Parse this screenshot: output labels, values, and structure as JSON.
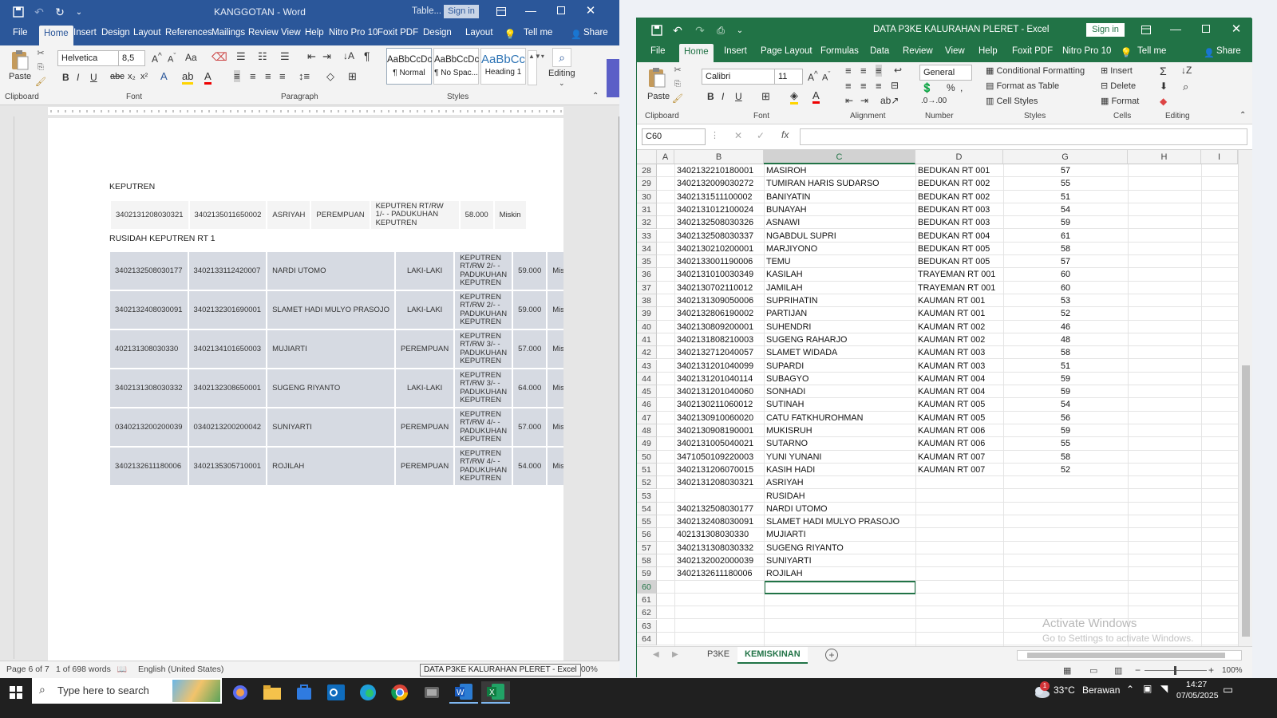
{
  "word": {
    "title": "KANGGOTAN - Word",
    "context_title": "Table...",
    "sign_in": "Sign in",
    "tabs": [
      "File",
      "Home",
      "Insert",
      "Design",
      "Layout",
      "References",
      "Mailings",
      "Review",
      "View",
      "Help",
      "Nitro Pro 10",
      "Foxit PDF",
      "Design",
      "Layout"
    ],
    "tell_me": "Tell me",
    "share": "Share",
    "ribbon": {
      "paste": "Paste",
      "font_name": "Helvetica",
      "font_size": "8,5",
      "clipboard": "Clipboard",
      "font": "Font",
      "paragraph": "Paragraph",
      "styles": "Styles",
      "editing": "Editing",
      "style_normal": "¶ Normal",
      "style_nospace": "¶ No Spac...",
      "style_heading": "Heading 1",
      "style_sample": "AaBbCcDc",
      "style_sample2": "AaBbCcDc",
      "style_sample3": "AaBbCc"
    },
    "doc": {
      "heading1": "KEPUTREN",
      "table1": [
        [
          "3402131208030321",
          "3402135011650002",
          "ASRIYAH",
          "PEREMPUAN",
          "KEPUTREN RT/RW 1/- - PADUKUHAN KEPUTREN",
          "58.000",
          "Miskin"
        ]
      ],
      "heading2": "RUSIDAH KEPUTREN RT 1",
      "table2": [
        [
          "3402132508030177",
          "3402133112420007",
          "NARDI UTOMO",
          "LAKI-LAKI",
          "KEPUTREN RT/RW 2/- - PADUKUHAN KEPUTREN",
          "59.000",
          "Mis"
        ],
        [
          "3402132408030091",
          "3402132301690001",
          "SLAMET HADI MULYO PRASOJO",
          "LAKI-LAKI",
          "KEPUTREN RT/RW 2/- - PADUKUHAN KEPUTREN",
          "59.000",
          "Mis"
        ],
        [
          "402131308030330",
          "3402134101650003",
          "MUJIARTI",
          "PEREMPUAN",
          "KEPUTREN RT/RW 3/- - PADUKUHAN KEPUTREN",
          "57.000",
          "Mis"
        ],
        [
          "3402131308030332",
          "3402132308650001",
          "SUGENG RIYANTO",
          "LAKI-LAKI",
          "KEPUTREN RT/RW 3/- - PADUKUHAN KEPUTREN",
          "64.000",
          "Mis"
        ],
        [
          "0340213200200039",
          "0340213200200042",
          "SUNIYARTI",
          "PEREMPUAN",
          "KEPUTREN RT/RW 4/- - PADUKUHAN KEPUTREN",
          "57.000",
          "Mis"
        ],
        [
          "3402132611180006",
          "3402135305710001",
          "ROJILAH",
          "PEREMPUAN",
          "KEPUTREN RT/RW 4/- - PADUKUHAN KEPUTREN",
          "54.000",
          "Mis"
        ]
      ]
    },
    "status": {
      "page": "Page 6 of 7",
      "words": "1 of 698 words",
      "language": "English (United States)",
      "zoom": "100%"
    }
  },
  "excel": {
    "title": "DATA P3KE KALURAHAN PLERET - Excel",
    "sign_in": "Sign in",
    "tabs": [
      "File",
      "Home",
      "Insert",
      "Page Layout",
      "Formulas",
      "Data",
      "Review",
      "View",
      "Help",
      "Foxit PDF",
      "Nitro Pro 10"
    ],
    "tell_me": "Tell me",
    "share": "Share",
    "ribbon": {
      "paste": "Paste",
      "font_name": "Calibri",
      "font_size": "11",
      "number_format": "General",
      "clipboard": "Clipboard",
      "font": "Font",
      "alignment": "Alignment",
      "number": "Number",
      "styles": "Styles",
      "cells": "Cells",
      "editing": "Editing",
      "conditional": "Conditional Formatting",
      "format_table": "Format as Table",
      "cell_styles": "Cell Styles",
      "insert": "Insert",
      "delete": "Delete",
      "format": "Format"
    },
    "name_box": "C60",
    "columns": [
      "A",
      "B",
      "C",
      "D",
      "G",
      "H",
      "I"
    ],
    "rows": [
      {
        "n": "28",
        "b": "3402132210180001",
        "c": "MASIROH",
        "d": "BEDUKAN RT 001",
        "g": "57"
      },
      {
        "n": "29",
        "b": "3402132009030272",
        "c": "TUMIRAN HARIS SUDARSO",
        "d": "BEDUKAN RT 002",
        "g": "55"
      },
      {
        "n": "30",
        "b": "3402131511100002",
        "c": "BANIYATIN",
        "d": "BEDUKAN RT 002",
        "g": "51"
      },
      {
        "n": "31",
        "b": "3402131012100024",
        "c": "BUNAYAH",
        "d": "BEDUKAN RT 003",
        "g": "54"
      },
      {
        "n": "32",
        "b": "3402132508030326",
        "c": "ASNAWI",
        "d": "BEDUKAN RT 003",
        "g": "59"
      },
      {
        "n": "33",
        "b": "3402132508030337",
        "c": "NGABDUL SUPRI",
        "d": "BEDUKAN RT 004",
        "g": "61"
      },
      {
        "n": "34",
        "b": "3402130210200001",
        "c": "MARJIYONO",
        "d": "BEDUKAN RT 005",
        "g": "58"
      },
      {
        "n": "35",
        "b": "3402133001190006",
        "c": "TEMU",
        "d": "BEDUKAN RT 005",
        "g": "57"
      },
      {
        "n": "36",
        "b": "3402131010030349",
        "c": "KASILAH",
        "d": "TRAYEMAN RT 001",
        "g": "60"
      },
      {
        "n": "37",
        "b": "3402130702110012",
        "c": "JAMILAH",
        "d": "TRAYEMAN RT 001",
        "g": "60"
      },
      {
        "n": "38",
        "b": "3402131309050006",
        "c": "SUPRIHATIN",
        "d": "KAUMAN RT 001",
        "g": "53"
      },
      {
        "n": "39",
        "b": "3402132806190002",
        "c": "PARTIJAN",
        "d": "KAUMAN RT 001",
        "g": "52"
      },
      {
        "n": "40",
        "b": "3402130809200001",
        "c": "SUHENDRI",
        "d": "KAUMAN RT 002",
        "g": "46"
      },
      {
        "n": "41",
        "b": "3402131808210003",
        "c": "SUGENG RAHARJO",
        "d": "KAUMAN RT 002",
        "g": "48"
      },
      {
        "n": "42",
        "b": "3402132712040057",
        "c": "SLAMET WIDADA",
        "d": "KAUMAN RT 003",
        "g": "58"
      },
      {
        "n": "43",
        "b": "3402131201040099",
        "c": "SUPARDI",
        "d": "KAUMAN RT 003",
        "g": "51"
      },
      {
        "n": "44",
        "b": "3402131201040114",
        "c": "SUBAGYO",
        "d": "KAUMAN RT 004",
        "g": "59"
      },
      {
        "n": "45",
        "b": "3402131201040060",
        "c": "SONHADI",
        "d": "KAUMAN RT 004",
        "g": "59"
      },
      {
        "n": "46",
        "b": "3402130211060012",
        "c": "SUTINAH",
        "d": "KAUMAN RT 005",
        "g": "54"
      },
      {
        "n": "47",
        "b": "3402130910060020",
        "c": "CATU FATKHUROHMAN",
        "d": "KAUMAN RT 005",
        "g": "56"
      },
      {
        "n": "48",
        "b": "3402130908190001",
        "c": "MUKISRUH",
        "d": "KAUMAN RT 006",
        "g": "59"
      },
      {
        "n": "49",
        "b": "3402131005040021",
        "c": "SUTARNO",
        "d": "KAUMAN RT 006",
        "g": "55"
      },
      {
        "n": "50",
        "b": "3471050109220003",
        "c": "YUNI YUNANI",
        "d": "KAUMAN RT 007",
        "g": "58"
      },
      {
        "n": "51",
        "b": "3402131206070015",
        "c": "KASIH HADI",
        "d": "KAUMAN RT 007",
        "g": "52"
      },
      {
        "n": "52",
        "b": "3402131208030321",
        "c": "ASRIYAH",
        "d": "",
        "g": ""
      },
      {
        "n": "53",
        "b": "",
        "c": "RUSIDAH",
        "d": "",
        "g": ""
      },
      {
        "n": "54",
        "b": "3402132508030177",
        "c": "NARDI UTOMO",
        "d": "",
        "g": ""
      },
      {
        "n": "55",
        "b": "3402132408030091",
        "c": "SLAMET HADI MULYO PRASOJO",
        "d": "",
        "g": ""
      },
      {
        "n": "56",
        "b": "402131308030330",
        "c": "MUJIARTI",
        "d": "",
        "g": ""
      },
      {
        "n": "57",
        "b": "3402131308030332",
        "c": "SUGENG RIYANTO",
        "d": "",
        "g": ""
      },
      {
        "n": "58",
        "b": "3402132002000039",
        "c": "SUNIYARTI",
        "d": "",
        "g": ""
      },
      {
        "n": "59",
        "b": "3402132611180006",
        "c": "ROJILAH",
        "d": "",
        "g": ""
      },
      {
        "n": "60",
        "b": "",
        "c": "",
        "d": "",
        "g": ""
      },
      {
        "n": "61",
        "b": "",
        "c": "",
        "d": "",
        "g": ""
      },
      {
        "n": "62",
        "b": "",
        "c": "",
        "d": "",
        "g": ""
      },
      {
        "n": "63",
        "b": "",
        "c": "",
        "d": "",
        "g": ""
      },
      {
        "n": "64",
        "b": "",
        "c": "",
        "d": "",
        "g": ""
      }
    ],
    "sheets": [
      "P3KE",
      "KEMISKINAN"
    ],
    "active_sheet": "KEMISKINAN",
    "watermark_title": "Activate Windows",
    "watermark_sub": "Go to Settings to activate Windows.",
    "zoom": "100%",
    "tooltip": "DATA P3KE KALURAHAN PLERET - Excel"
  },
  "taskbar": {
    "search_placeholder": "Type here to search",
    "weather_temp": "33°C",
    "weather_desc": "Berawan",
    "time": "14:27",
    "date": "07/05/2025",
    "notification_badge": "1"
  },
  "colors": {
    "word_blue": "#2b579a",
    "excel_green": "#217346",
    "taskbar": "#202020"
  }
}
